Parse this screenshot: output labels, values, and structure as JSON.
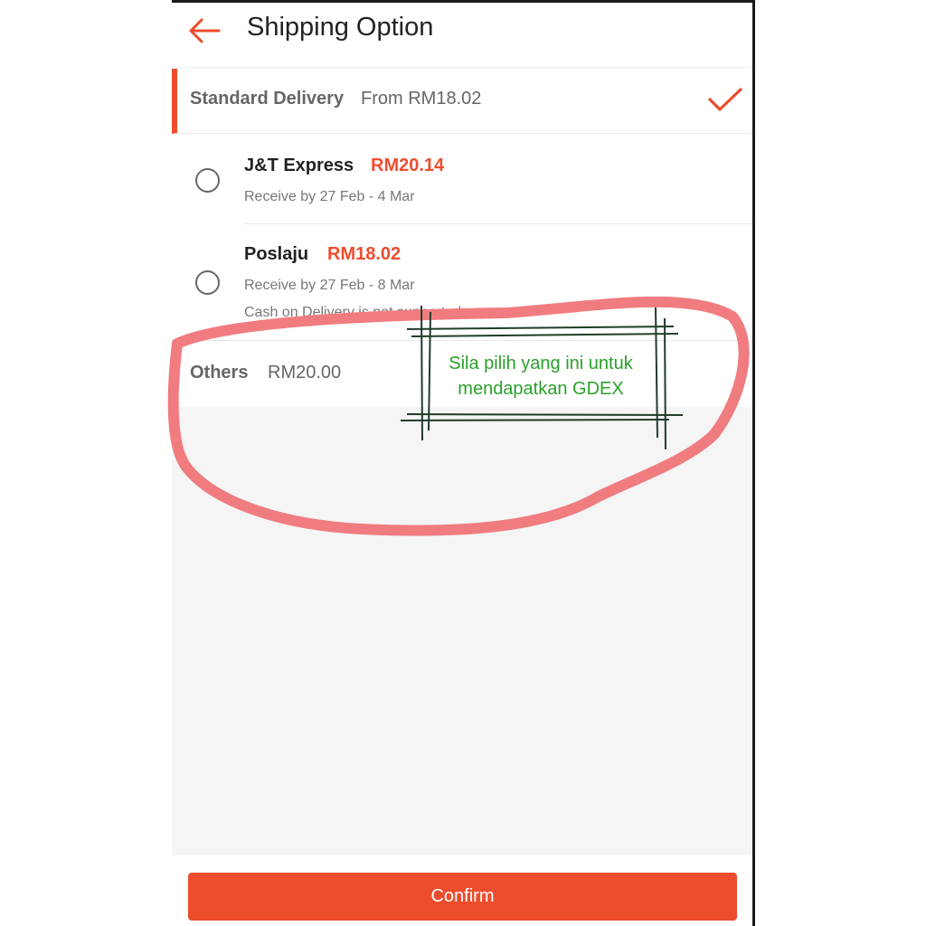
{
  "header": {
    "back_icon": "arrow-left-icon",
    "title": "Shipping Option"
  },
  "standard": {
    "name": "Standard Delivery",
    "price": "From RM18.02",
    "selected_icon": "check-icon"
  },
  "options": [
    {
      "name": "J&T Express",
      "price": "RM20.14",
      "receive": "Receive by 27 Feb - 4 Mar",
      "selected": false
    },
    {
      "name": "Poslaju",
      "price": "RM18.02",
      "receive": "Receive by 27 Feb - 8 Mar",
      "note": "Cash on Delivery is not supported",
      "selected": false
    }
  ],
  "others": {
    "name": "Others",
    "price": "RM20.00"
  },
  "annotation": {
    "line1": "Sila pilih yang ini untuk",
    "line2": "mendapatkan GDEX"
  },
  "footer": {
    "confirm_label": "Confirm"
  },
  "colors": {
    "accent": "#ee4d2d",
    "annotation_circle": "#f07c80",
    "annotation_text": "#2aa02a",
    "annotation_box": "#1f3d2a"
  }
}
